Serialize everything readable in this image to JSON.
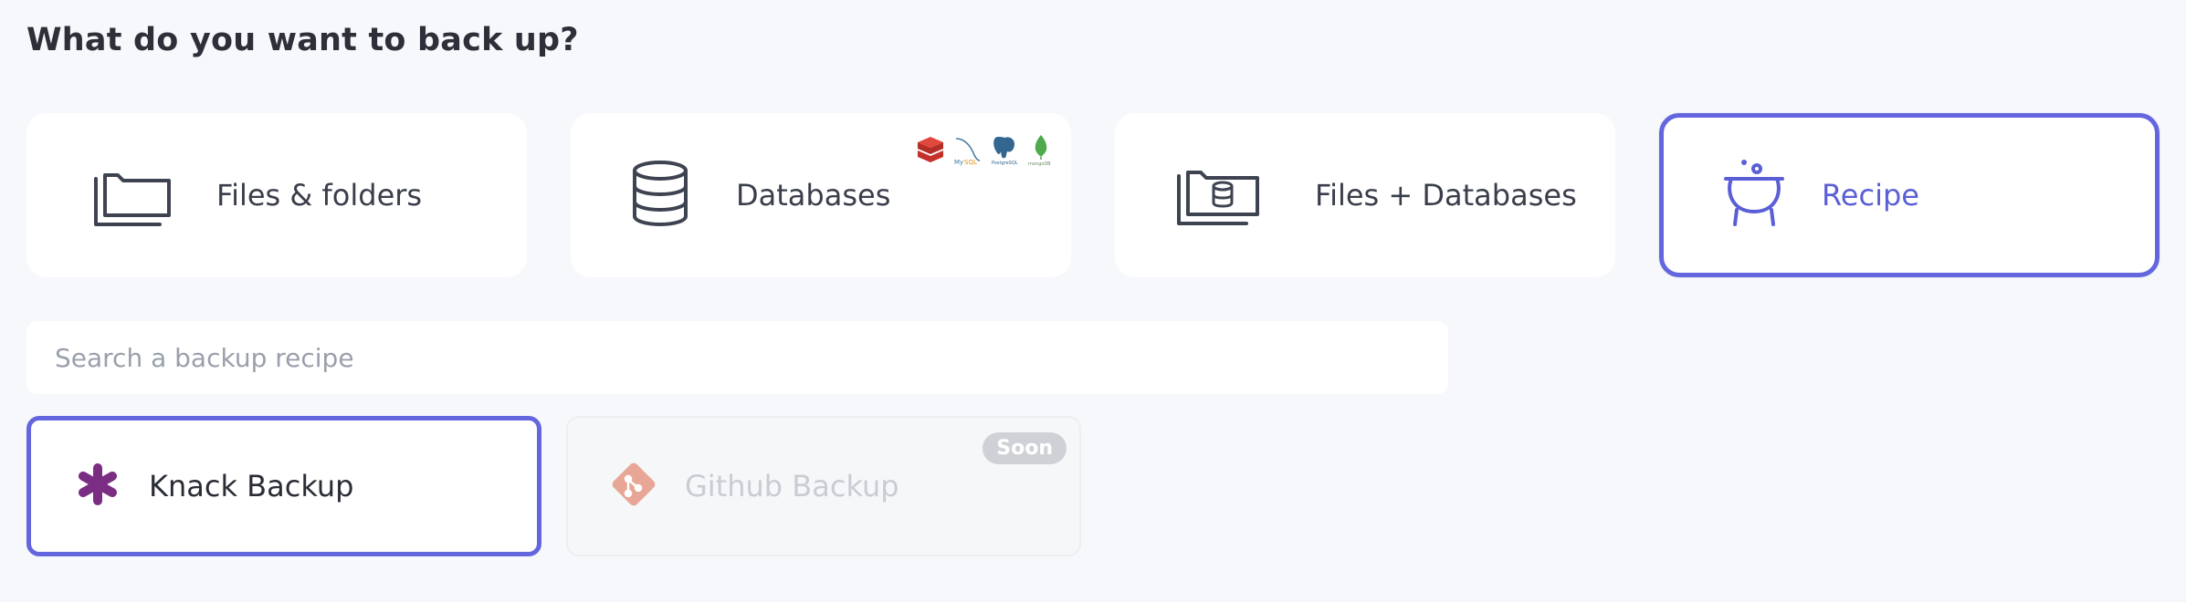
{
  "page": {
    "heading": "What do you want to back up?"
  },
  "backup_types": [
    {
      "label": "Files & folders",
      "icon": "folder-icon",
      "selected": false
    },
    {
      "label": "Databases",
      "icon": "database-icon",
      "selected": false,
      "logos": [
        "redis-logo",
        "mysql-logo",
        "postgresql-logo",
        "mongodb-logo"
      ]
    },
    {
      "label": "Files + Databases",
      "icon": "folder-database-icon",
      "selected": false
    },
    {
      "label": "Recipe",
      "icon": "cauldron-icon",
      "selected": true
    }
  ],
  "search": {
    "placeholder": "Search a backup recipe",
    "value": ""
  },
  "recipes": [
    {
      "label": "Knack Backup",
      "icon": "knack-icon",
      "selected": true,
      "disabled": false
    },
    {
      "label": "Github Backup",
      "icon": "git-icon",
      "selected": false,
      "disabled": true,
      "badge": "Soon"
    }
  ],
  "colors": {
    "accent": "#6366dd",
    "background": "#f7f8fb",
    "card": "#ffffff",
    "knack": "#7b2d83",
    "git": "#e8a796",
    "redis": "#c6302b",
    "mongodb": "#4fa94d"
  }
}
